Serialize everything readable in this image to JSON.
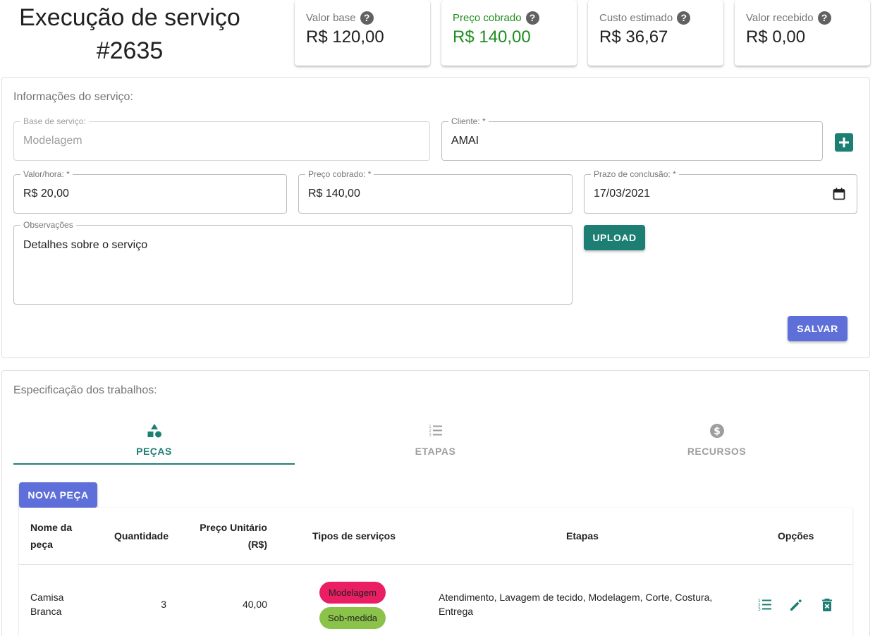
{
  "header": {
    "title_line1": "Execução de serviço",
    "title_line2": "#2635"
  },
  "stats": [
    {
      "label": "Valor base",
      "value": "R$ 120,00"
    },
    {
      "label": "Preço cobrado",
      "value": "R$ 140,00"
    },
    {
      "label": "Custo estimado",
      "value": "R$ 36,67"
    },
    {
      "label": "Valor recebido",
      "value": "R$ 0,00"
    }
  ],
  "service_info": {
    "heading": "Informações do serviço:",
    "base_label": "Base de serviço:",
    "base_value": "Modelagem",
    "client_label": "Cliente: *",
    "client_value": "AMAI",
    "hourly_label": "Valor/hora: *",
    "hourly_value": "R$ 20,00",
    "price_label": "Preço cobrado: *",
    "price_value": "R$ 140,00",
    "deadline_label": "Prazo de conclusão: *",
    "deadline_value": "17/03/2021",
    "notes_label": "Observações",
    "notes_value": "Detalhes sobre o serviço",
    "upload_label": "UPLOAD",
    "save_label": "SALVAR"
  },
  "work_spec": {
    "heading": "Especificação dos trabalhos:",
    "tabs": [
      {
        "label": "PEÇAS",
        "icon": "shapes-icon",
        "active": true
      },
      {
        "label": "ETAPAS",
        "icon": "numbered-list-icon",
        "active": false
      },
      {
        "label": "RECURSOS",
        "icon": "dollar-circle-icon",
        "active": false
      }
    ],
    "new_piece_label": "NOVA PEÇA",
    "table": {
      "headers": {
        "name_line1": "Nome da",
        "name_line2": "peça",
        "quantity": "Quantidade",
        "unit_price_line1": "Preço Unitário",
        "unit_price_line2": "(R$)",
        "service_types": "Tipos de serviços",
        "steps": "Etapas",
        "options": "Opções"
      },
      "rows": [
        {
          "name_line1": "Camisa",
          "name_line2": "Branca",
          "quantity": "3",
          "unit_price": "40,00",
          "service_types": [
            "Modelagem",
            "Sob-medida"
          ],
          "steps_line1": "Atendimento, Lavagem de tecido, Modelagem, Corte, Costura,",
          "steps_line2": "Entrega"
        }
      ]
    }
  },
  "colors": {
    "primary_teal": "#1d7f74",
    "indigo": "#5f6fd9",
    "price_green": "#1e8e1e",
    "chip_pink": "#e91e63",
    "chip_green": "#8bc34a"
  }
}
